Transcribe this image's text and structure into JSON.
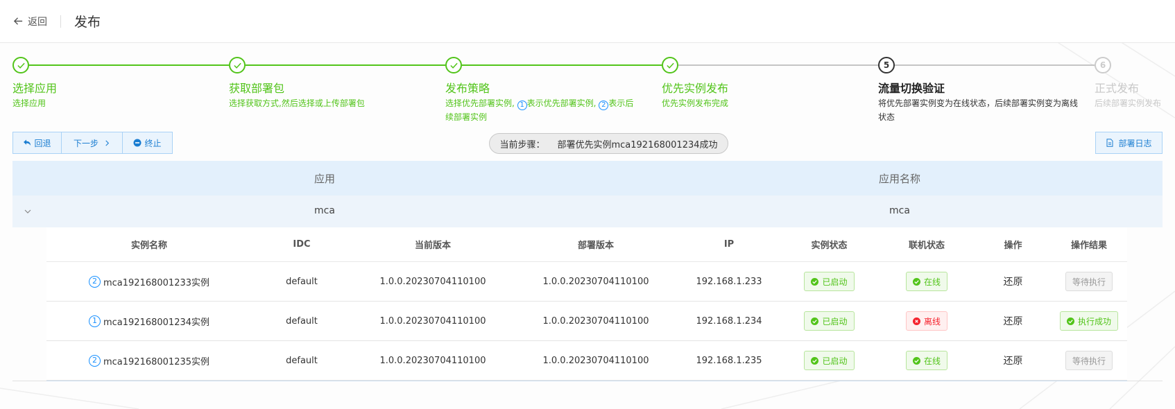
{
  "header": {
    "back_label": "返回",
    "title": "发布"
  },
  "colors": {
    "done": "#52c41a",
    "active": "#333333",
    "wait": "#cccccc",
    "accent": "#1890ff",
    "danger": "#f5222d"
  },
  "steps": [
    {
      "title": "选择应用",
      "desc": "选择应用",
      "status": "done"
    },
    {
      "title": "获取部署包",
      "desc": "选择获取方式,然后选择或上传部署包",
      "status": "done"
    },
    {
      "title": "发布策略",
      "desc_a": "选择优先部署实例,",
      "num1": "1",
      "desc_b": "表示优先部署实例,",
      "num2": "2",
      "desc_c": "表示后续部署实例",
      "status": "done"
    },
    {
      "title": "优先实例发布",
      "desc": "优先实例发布完成",
      "status": "done"
    },
    {
      "number": "5",
      "title": "流量切换验证",
      "desc": "将优先部署实例变为在线状态，后续部署实例变为离线状态",
      "status": "active"
    },
    {
      "number": "6",
      "title": "正式发布",
      "desc": "后续部署实例发布",
      "status": "wait"
    }
  ],
  "actions": {
    "rollback": "回退",
    "next": "下一步",
    "stop": "终止",
    "log": "部署日志"
  },
  "current_step": {
    "label": "当前步骤：",
    "value": "部署优先实例mca192168001234成功"
  },
  "outer_table": {
    "headers": [
      "应用",
      "应用名称"
    ],
    "row": {
      "app": "mca",
      "app_name": "mca"
    }
  },
  "inner_table": {
    "headers": [
      "实例名称",
      "IDC",
      "当前版本",
      "部署版本",
      "IP",
      "实例状态",
      "联机状态",
      "操作",
      "操作结果"
    ],
    "rows": [
      {
        "badge": "2",
        "name": "mca192168001233实例",
        "idc": "default",
        "current_version": "1.0.0.20230704110100",
        "deploy_version": "1.0.0.20230704110100",
        "ip": "192.168.1.233",
        "instance_status": "已启动",
        "online_status": "在线",
        "online_ok": true,
        "operation": "还原",
        "result": "等待执行",
        "result_ok": false
      },
      {
        "badge": "1",
        "name": "mca192168001234实例",
        "idc": "default",
        "current_version": "1.0.0.20230704110100",
        "deploy_version": "1.0.0.20230704110100",
        "ip": "192.168.1.234",
        "instance_status": "已启动",
        "online_status": "离线",
        "online_ok": false,
        "operation": "还原",
        "result": "执行成功",
        "result_ok": true
      },
      {
        "badge": "2",
        "name": "mca192168001235实例",
        "idc": "default",
        "current_version": "1.0.0.20230704110100",
        "deploy_version": "1.0.0.20230704110100",
        "ip": "192.168.1.235",
        "instance_status": "已启动",
        "online_status": "在线",
        "online_ok": true,
        "operation": "还原",
        "result": "等待执行",
        "result_ok": false
      }
    ]
  }
}
